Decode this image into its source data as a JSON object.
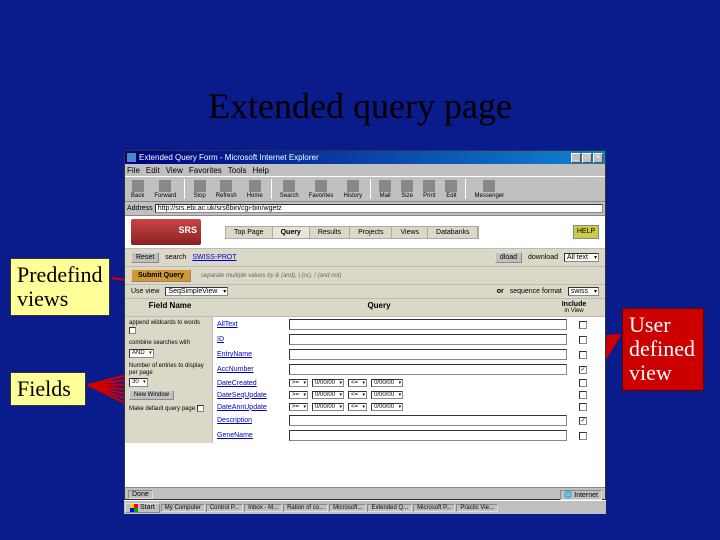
{
  "slide_title": "Extended query page",
  "annotations": {
    "predefind_views": "Predefind\nviews",
    "fields": "Fields",
    "user_defined_view": "User\ndefined\nview"
  },
  "browser": {
    "title": "Extended Query Form - Microsoft Internet Explorer",
    "menus": [
      "File",
      "Edit",
      "View",
      "Favorites",
      "Tools",
      "Help"
    ],
    "toolbar": [
      "Back",
      "Forward",
      "Stop",
      "Refresh",
      "Home",
      "Search",
      "Favorites",
      "History",
      "Mail",
      "Size",
      "Print",
      "Edit",
      "Messenger"
    ],
    "address_label": "Address",
    "address_value": "http://srs.ebi.ac.uk/srs6bin/cgi-bin/wgetz"
  },
  "srs": {
    "tabs": [
      "Top Page",
      "Query",
      "Results",
      "Projects",
      "Views",
      "Databanks"
    ],
    "active_tab": 1,
    "help": "HELP",
    "reset_btn": "Reset",
    "search_label": "search",
    "search_db": "SWISS-PROT",
    "download_btn": "dload",
    "download_label": "download",
    "download_value": "All text",
    "submit_btn": "Submit Query",
    "combine_note": "separate multiple values by & (and), | (or), ! (and not)",
    "use_view_label": "Use view",
    "use_view_value": "SeqSimpleView",
    "or_label": "or",
    "seq_format_label": "sequence format",
    "seq_format_value": "swiss",
    "col_field": "Field Name",
    "col_query": "Query",
    "col_include": "Include",
    "col_include_sub": "in View",
    "left_options": {
      "wildcards_label": "append wildcards to words",
      "combine_label": "combine searches with",
      "combine_value": "AND",
      "entries_label": "Number of entries to display per page",
      "entries_value": "30",
      "newwindow_btn": "New Window",
      "default_label": "Make default query page"
    },
    "fields": [
      {
        "name": "AllText",
        "type": "text",
        "included": false
      },
      {
        "name": "ID",
        "type": "text",
        "included": false
      },
      {
        "name": "EntryName",
        "type": "text",
        "included": false
      },
      {
        "name": "AccNumber",
        "type": "text",
        "included": true
      },
      {
        "name": "DateCreated",
        "type": "date",
        "included": false
      },
      {
        "name": "DateSeqUpdate",
        "type": "date",
        "included": false
      },
      {
        "name": "DateAnnUpdate",
        "type": "date",
        "included": false
      },
      {
        "name": "Description",
        "type": "text",
        "included": true
      },
      {
        "name": "GeneName",
        "type": "text",
        "included": false
      }
    ],
    "date_ops": [
      ">=",
      "<="
    ],
    "date_default": "0/00/00"
  },
  "statusbar": {
    "done": "Done",
    "zone": "Internet"
  },
  "taskbar": {
    "start": "Start",
    "items": [
      "My Computer",
      "Control P...",
      "Inbox - M...",
      "Ration of co...",
      "Microsoft...",
      "Extended Q...",
      "Microsoft P...",
      "Practic Vie..."
    ]
  }
}
